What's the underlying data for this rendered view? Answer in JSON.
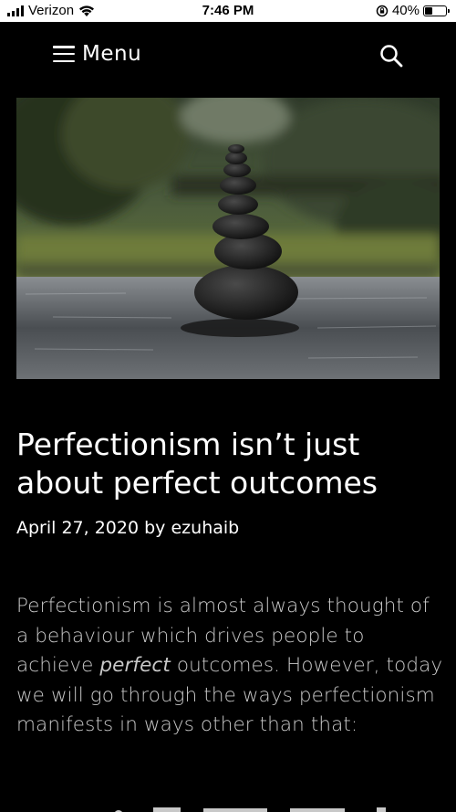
{
  "status_bar": {
    "carrier": "Verizon",
    "time": "7:46 PM",
    "battery_percent": "40%",
    "battery_level": 0.4,
    "icons": [
      "signal-icon",
      "wifi-icon",
      "orientation-lock-icon",
      "battery-icon"
    ]
  },
  "nav": {
    "menu_label": "Menu",
    "menu_icon": "hamburger-icon",
    "search_icon": "search-icon"
  },
  "post": {
    "title_line1": "Perfectionism isn’t just",
    "title_line2": "about perfect outcomes",
    "date": "April 27, 2020",
    "by": "by",
    "author": "ezuhaib",
    "paragraph_before_em": "Perfectionism is almost always thought of a behaviour which drives people to achieve ",
    "paragraph_em": "perfect",
    "paragraph_after_em": " outcomes. However, today we will go through the ways perfectionism manifests in ways other than that:"
  },
  "colors": {
    "background": "#000000",
    "text": "#ffffff",
    "body_text": "#c8c8c8"
  }
}
